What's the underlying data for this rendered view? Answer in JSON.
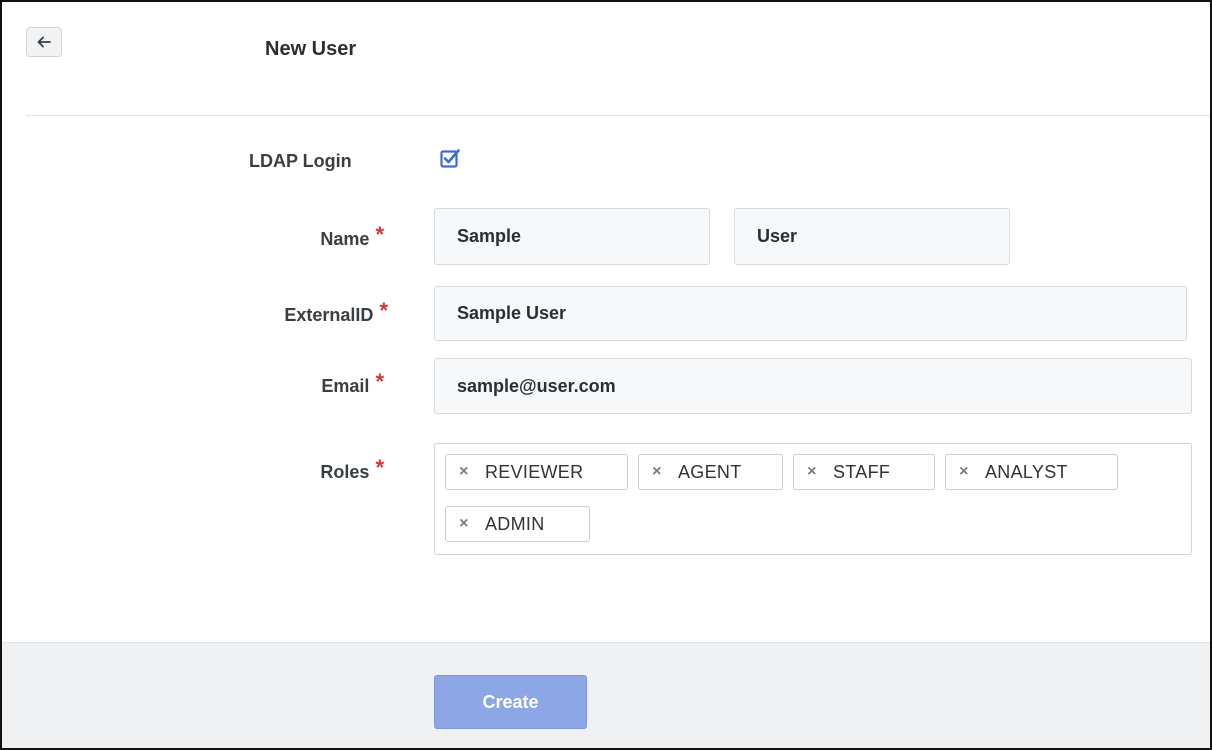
{
  "header": {
    "title": "New User",
    "back_icon": "arrow-left-icon"
  },
  "form": {
    "ldap": {
      "label": "LDAP Login",
      "checked": true,
      "accent": "#3d6bd6"
    },
    "name": {
      "label": "Name",
      "required_mark": "*",
      "first_value": "Sample",
      "last_value": "User"
    },
    "external_id": {
      "label": "ExternalID",
      "required_mark": "*",
      "value": "Sample User"
    },
    "email": {
      "label": "Email",
      "required_mark": "*",
      "value": "sample@user.com"
    },
    "roles": {
      "label": "Roles",
      "required_mark": "*",
      "remove_glyph": "×",
      "tags": [
        "REVIEWER",
        "AGENT",
        "STAFF",
        "ANALYST",
        "ADMIN"
      ]
    }
  },
  "footer": {
    "create_label": "Create",
    "button_color": "#8ca6e6"
  },
  "colors": {
    "required": "#d0393b",
    "checkbox": "#3d6bd6"
  }
}
